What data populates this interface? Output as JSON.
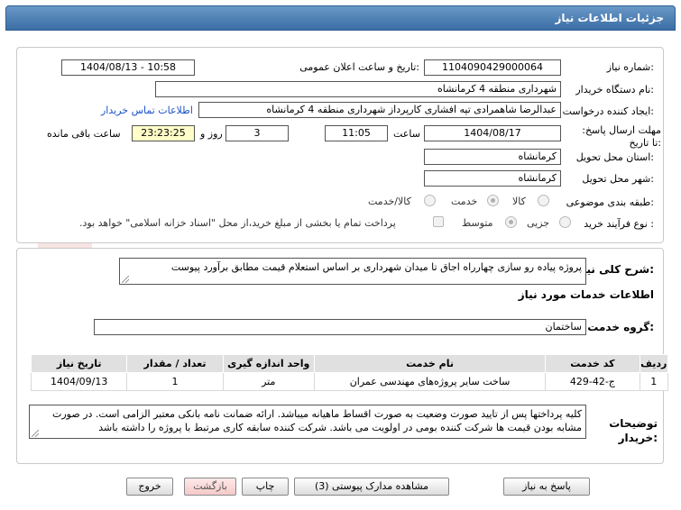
{
  "header": {
    "title": "جزئیات اطلاعات نیاز"
  },
  "fields": {
    "need_number_label": "شماره نیاز:",
    "need_number": "1104090429000064",
    "announce_label": "تاریخ و ساعت اعلان عمومی:",
    "announce_value": "1404/08/13 - 10:58",
    "buyer_org_label": "نام دستگاه خریدار:",
    "buyer_org": "شهرداری منطقه 4 کرمانشاه",
    "creator_label": "ایجاد کننده درخواست:",
    "creator": "عبدالرضا شاهمرادی تپه افشاری کارپرداز شهرداری منطقه 4 کرمانشاه",
    "contact_link": "اطلاعات تماس خریدار",
    "deadline_label": "مهلت ارسال پاسخ: تا تاریخ:",
    "deadline_date": "1404/08/17",
    "hour_label": "ساعت",
    "deadline_time": "11:05",
    "days_value": "3",
    "days_label": "روز و",
    "remaining_time": "23:23:25",
    "remaining_label": "ساعت باقی مانده",
    "province_label": "استان محل تحویل:",
    "province": "کرمانشاه",
    "city_label": "شهر محل تحویل:",
    "city": "کرمانشاه",
    "category_label": "طبقه بندی موضوعی:",
    "category_options": [
      "کالا",
      "خدمت",
      "کالا/خدمت"
    ],
    "category_selected": "خدمت",
    "process_label": "نوع فرآیند خرید :",
    "process_options": [
      "جزیی",
      "متوسط"
    ],
    "process_selected": "متوسط",
    "payment_note": "پرداخت تمام یا بخشی از مبلغ خرید،از محل \"اسناد خزانه اسلامی\" خواهد بود."
  },
  "details": {
    "description_label": "شرح کلی نیاز:",
    "description": "پروژه پیاده رو سازی چهارراه اجاق تا میدان شهرداری بر اساس استعلام قیمت مطابق برآورد پیوست",
    "services_title": "اطلاعات خدمات مورد نیاز",
    "service_group_label": "گروه خدمت:",
    "service_group": "ساختمان",
    "table_headers": [
      "ردیف",
      "کد خدمت",
      "نام خدمت",
      "واحد اندازه گیری",
      "تعداد / مقدار",
      "تاریخ نیاز"
    ],
    "table_rows": [
      [
        "1",
        "ج-42-429",
        "ساخت سایر پروژه‌های مهندسی عمران",
        "متر",
        "1",
        "1404/09/13"
      ]
    ],
    "buyer_notes_label": "توضیحات خریدار:",
    "buyer_notes": "کلیه پرداختها پس از تایید صورت وضعیت به صورت اقساط ماهیانه میباشد. ارائه ضمانت نامه بانکی معتبر الزامی است. در صورت مشابه بودن قیمت ها شرکت کننده بومی در اولویت می باشد. شرکت کننده سابقه کاری مرتبط با پروژه را داشته باشد"
  },
  "buttons": {
    "reply": "پاسخ به نیاز",
    "attachments": "مشاهده مدارک پیوستی (3)",
    "print": "چاپ",
    "back": "بازگشت",
    "exit": "خروج"
  },
  "watermark": {
    "text": "AriaTender.net",
    "color": "#c0392b"
  }
}
